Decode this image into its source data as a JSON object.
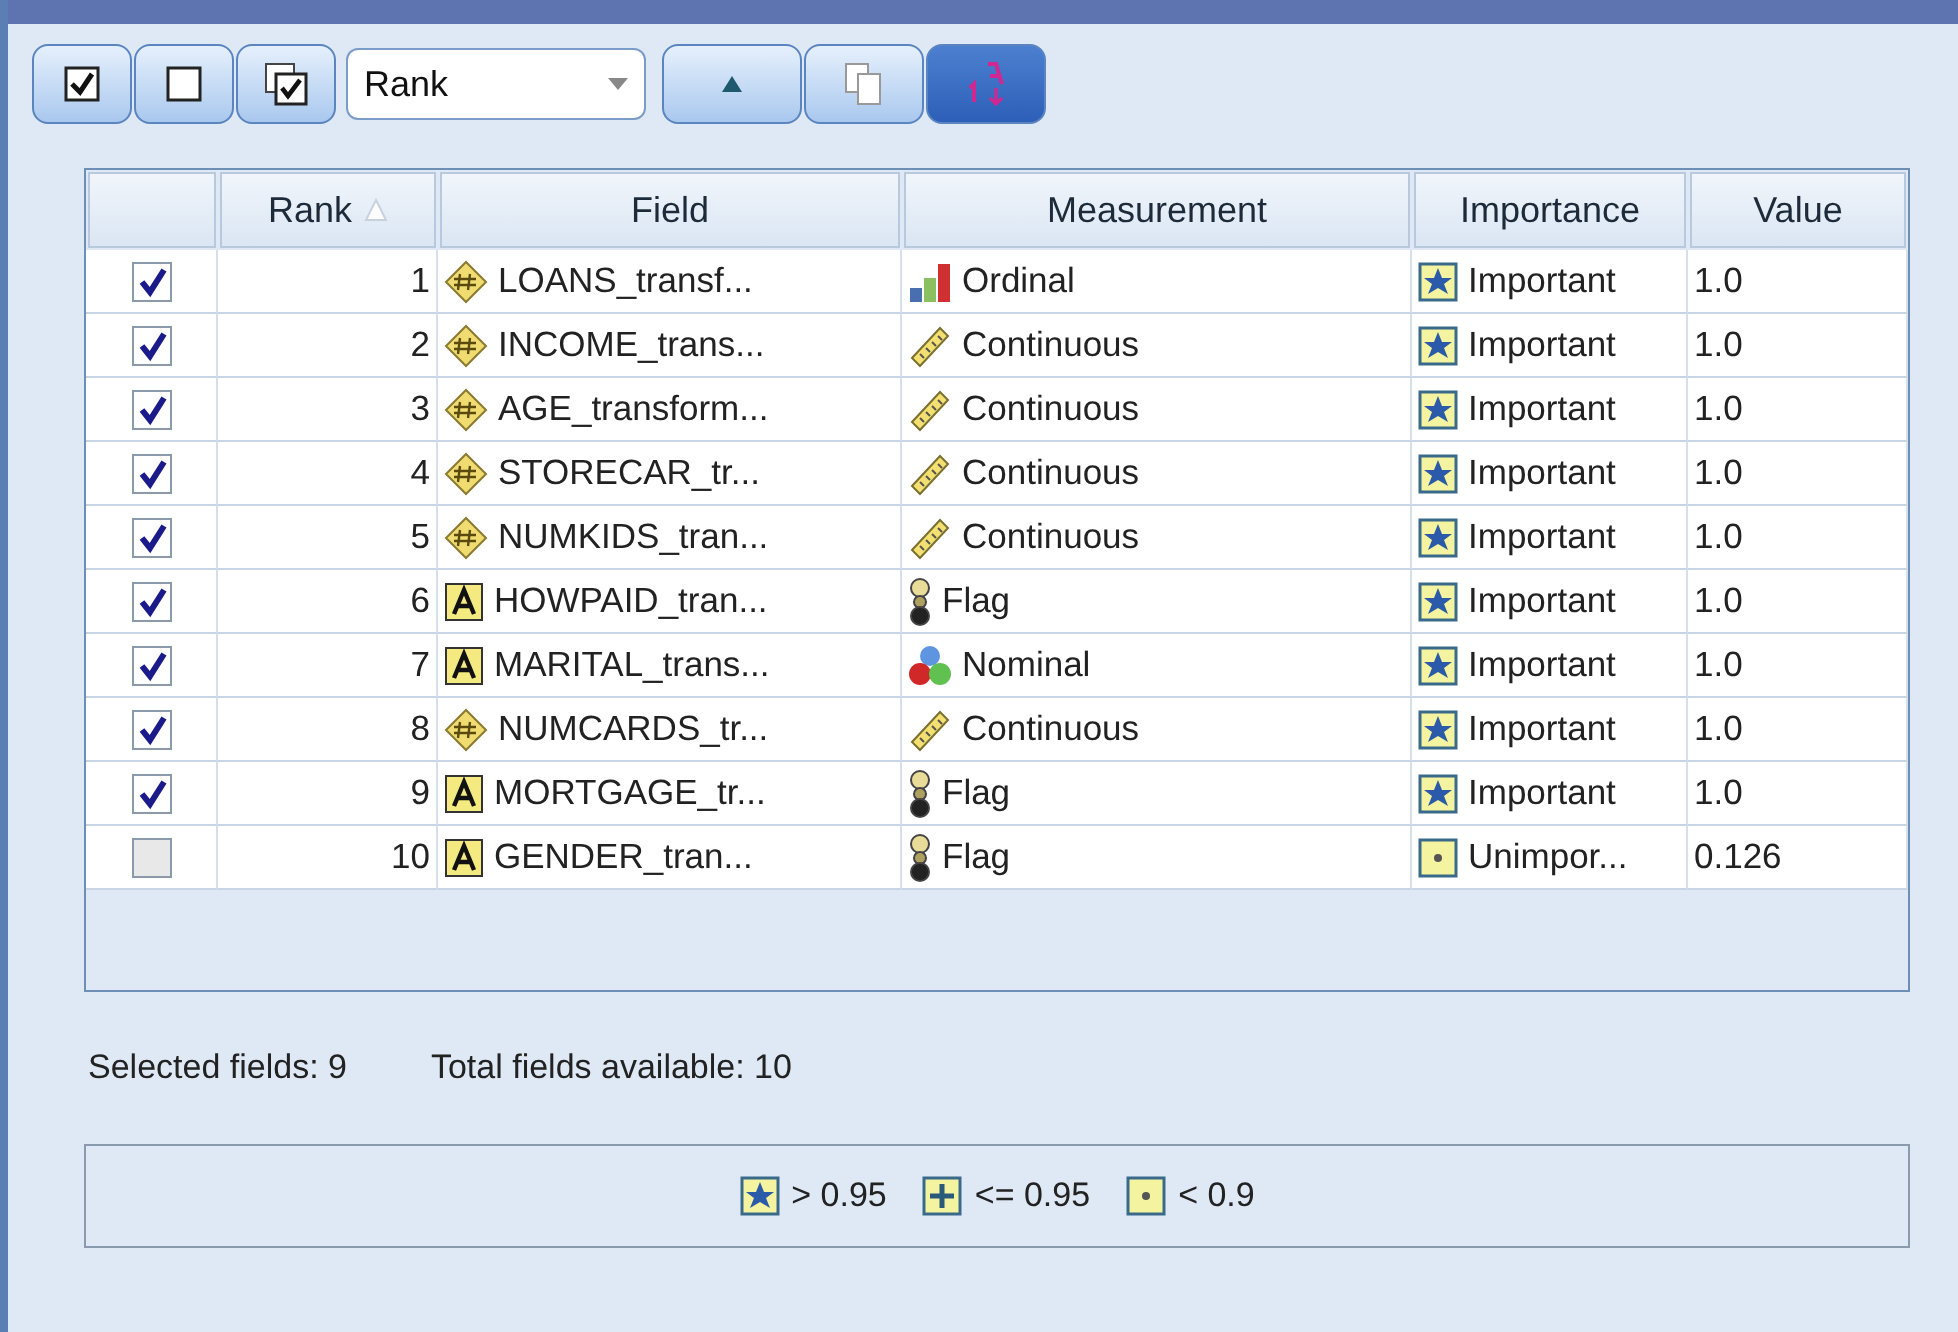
{
  "toolbar": {
    "buttons": [
      {
        "kind": "check-all",
        "pressed": false
      },
      {
        "kind": "uncheck-all",
        "pressed": false
      },
      {
        "kind": "check-top",
        "pressed": false
      }
    ],
    "sort_select": {
      "value": "Rank"
    },
    "sort_buttons": [
      {
        "kind": "ascending",
        "pressed": false
      },
      {
        "kind": "copy",
        "pressed": false
      },
      {
        "kind": "sort-order",
        "pressed": true
      }
    ]
  },
  "table": {
    "columns": [
      {
        "sorted": false
      },
      {
        "label": "Rank",
        "sorted": true
      },
      {
        "label": "Field",
        "sorted": false
      },
      {
        "label": "Measurement",
        "sorted": false
      },
      {
        "label": "Importance",
        "sorted": false
      },
      {
        "label": "Value",
        "sorted": false
      }
    ],
    "rows": [
      {
        "checked": true,
        "rank": "1",
        "field": {
          "kind": "numeric",
          "name": "LOANS_transf..."
        },
        "measurement": {
          "kind": "ordinal",
          "label": "Ordinal"
        },
        "importance": {
          "kind": "important",
          "label": "Important"
        },
        "value": "1.0"
      },
      {
        "checked": true,
        "rank": "2",
        "field": {
          "kind": "numeric",
          "name": "INCOME_trans..."
        },
        "measurement": {
          "kind": "continuous",
          "label": "Continuous"
        },
        "importance": {
          "kind": "important",
          "label": "Important"
        },
        "value": "1.0"
      },
      {
        "checked": true,
        "rank": "3",
        "field": {
          "kind": "numeric",
          "name": "AGE_transform..."
        },
        "measurement": {
          "kind": "continuous",
          "label": "Continuous"
        },
        "importance": {
          "kind": "important",
          "label": "Important"
        },
        "value": "1.0"
      },
      {
        "checked": true,
        "rank": "4",
        "field": {
          "kind": "numeric",
          "name": "STORECAR_tr..."
        },
        "measurement": {
          "kind": "continuous",
          "label": "Continuous"
        },
        "importance": {
          "kind": "important",
          "label": "Important"
        },
        "value": "1.0"
      },
      {
        "checked": true,
        "rank": "5",
        "field": {
          "kind": "numeric",
          "name": "NUMKIDS_tran..."
        },
        "measurement": {
          "kind": "continuous",
          "label": "Continuous"
        },
        "importance": {
          "kind": "important",
          "label": "Important"
        },
        "value": "1.0"
      },
      {
        "checked": true,
        "rank": "6",
        "field": {
          "kind": "string",
          "name": "HOWPAID_tran..."
        },
        "measurement": {
          "kind": "flag",
          "label": "Flag"
        },
        "importance": {
          "kind": "important",
          "label": "Important"
        },
        "value": "1.0"
      },
      {
        "checked": true,
        "rank": "7",
        "field": {
          "kind": "string",
          "name": "MARITAL_trans..."
        },
        "measurement": {
          "kind": "nominal",
          "label": "Nominal"
        },
        "importance": {
          "kind": "important",
          "label": "Important"
        },
        "value": "1.0"
      },
      {
        "checked": true,
        "rank": "8",
        "field": {
          "kind": "numeric",
          "name": "NUMCARDS_tr..."
        },
        "measurement": {
          "kind": "continuous",
          "label": "Continuous"
        },
        "importance": {
          "kind": "important",
          "label": "Important"
        },
        "value": "1.0"
      },
      {
        "checked": true,
        "rank": "9",
        "field": {
          "kind": "string",
          "name": "MORTGAGE_tr..."
        },
        "measurement": {
          "kind": "flag",
          "label": "Flag"
        },
        "importance": {
          "kind": "important",
          "label": "Important"
        },
        "value": "1.0"
      },
      {
        "checked": false,
        "rank": "10",
        "field": {
          "kind": "string",
          "name": "GENDER_tran..."
        },
        "measurement": {
          "kind": "flag",
          "label": "Flag"
        },
        "importance": {
          "kind": "unimportant",
          "label": "Unimpor..."
        },
        "value": "0.126"
      }
    ]
  },
  "summary": {
    "selected": "Selected fields: 9",
    "total": "Total fields available: 10"
  },
  "legend": [
    {
      "kind": "important",
      "label": "> 0.95"
    },
    {
      "kind": "marginal",
      "label": "<= 0.95"
    },
    {
      "kind": "unimportant",
      "label": "< 0.9"
    }
  ]
}
